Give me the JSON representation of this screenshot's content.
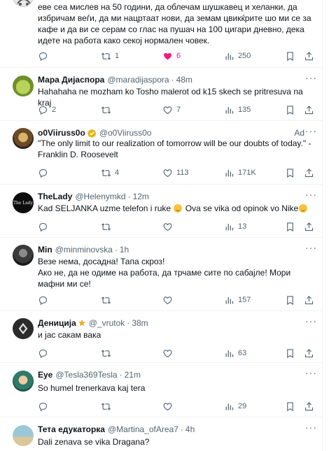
{
  "tweets": [
    {
      "text": "еве сеа мислев на 50 години, да облечам шушкавец и хеланки, да избричам веѓи, да ми нацртаат нови, да земам цвикќрите шо ми се за кафе и да ви се серам со глас на пушач на 100 цигари дневно, дека идете на работа како секој нормален човек.",
      "reply": "",
      "retweet": "1",
      "like": "6",
      "views": "250"
    },
    {
      "name": "Мара Дијаспора",
      "handle": "@maradijaspora",
      "time": "48m",
      "text": "Hahahaha ne mozham ko Tosho malerot od k15 skech se pritresuva na kraj",
      "reply": "2",
      "retweet": "",
      "like": "7",
      "views": "135"
    },
    {
      "name": "o0Viiruss0o",
      "handle": "@o0Viiruss0o",
      "ad": "Ad",
      "text": "\"The only limit to our realization of tomorrow will be our doubts of today.\" - Franklin D. Roosevelt",
      "reply": "",
      "retweet": "4",
      "like": "113",
      "views": "171K"
    },
    {
      "name": "TheLady",
      "handle": "@Helenymkd",
      "time": "12m",
      "avatar_text": "The Lady",
      "text_a": "Kad SELJANKA uzme telefon i ruke",
      "text_b": "Ova se vika od opinok vo Nike",
      "reply": "",
      "retweet": "",
      "like": "",
      "views": "13"
    },
    {
      "name": "Min",
      "handle": "@minminovska",
      "time": "1h",
      "text": "Везе нема, досадна! Тапа скроз!\nАко не, да не одиме на работа, да трчаме сите по сабајле! Мори мафни ми се!",
      "reply": "",
      "retweet": "",
      "like": "",
      "views": "157"
    },
    {
      "name": "Дениција",
      "handle": "@_vrutok",
      "time": "38m",
      "text": "и јас сакам вака",
      "reply": "",
      "retweet": "",
      "like": "",
      "views": "63"
    },
    {
      "name": "Eye",
      "handle": "@Tesla369Tesla",
      "time": "21m",
      "text": "So humel trenerkava kaj tera",
      "reply": "",
      "retweet": "",
      "like": "",
      "views": "29"
    },
    {
      "name": "Тета едукаторка",
      "handle": "@Martina_ofArea7",
      "time": "4h",
      "text": "Dali zenava se vika Dragana?"
    }
  ],
  "ui": {
    "separator": "·",
    "more": "···"
  },
  "colors": {
    "text": "#0f1419",
    "secondary": "#536471",
    "like_active": "#f91880",
    "verified_gold": "#e2b719",
    "border": "#eff3f4"
  }
}
